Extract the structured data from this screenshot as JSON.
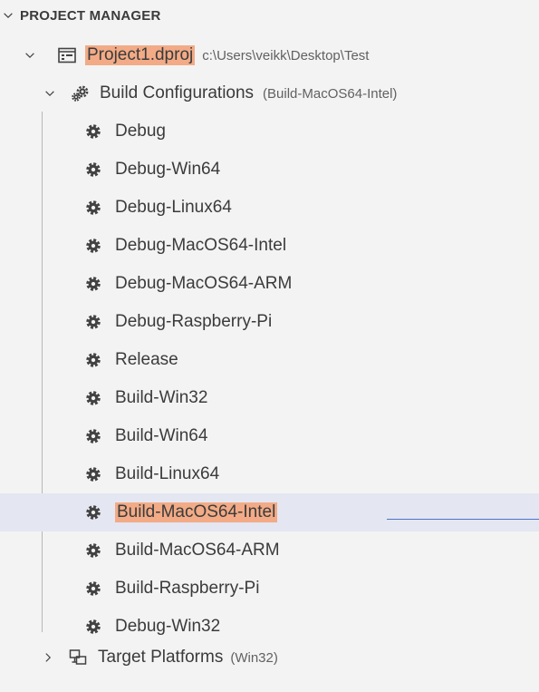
{
  "section": {
    "title": "PROJECT MANAGER"
  },
  "project": {
    "name": "Project1.dproj",
    "path": "c:\\Users\\veikk\\Desktop\\Test"
  },
  "build_configs": {
    "label": "Build Configurations",
    "description": "(Build-MacOS64-Intel)",
    "items": [
      "Debug",
      "Debug-Win64",
      "Debug-Linux64",
      "Debug-MacOS64-Intel",
      "Debug-MacOS64-ARM",
      "Debug-Raspberry-Pi",
      "Release",
      "Build-Win32",
      "Build-Win64",
      "Build-Linux64",
      "Build-MacOS64-Intel",
      "Build-MacOS64-ARM",
      "Build-Raspberry-Pi",
      "Debug-Win32"
    ],
    "selected": "Build-MacOS64-Intel"
  },
  "target_platforms": {
    "label": "Target Platforms",
    "description": "(Win32)"
  },
  "colors": {
    "highlight": "#f2ab86",
    "selection_bg": "#e4e6f1",
    "drop_line": "#4a74c9"
  },
  "icons": {
    "chevron_down": "chevron-down-icon",
    "chevron_right": "chevron-right-icon",
    "project": "project-file-icon",
    "build_configs": "build-configurations-icon",
    "config": "gear-icon",
    "platforms": "target-platforms-icon"
  }
}
